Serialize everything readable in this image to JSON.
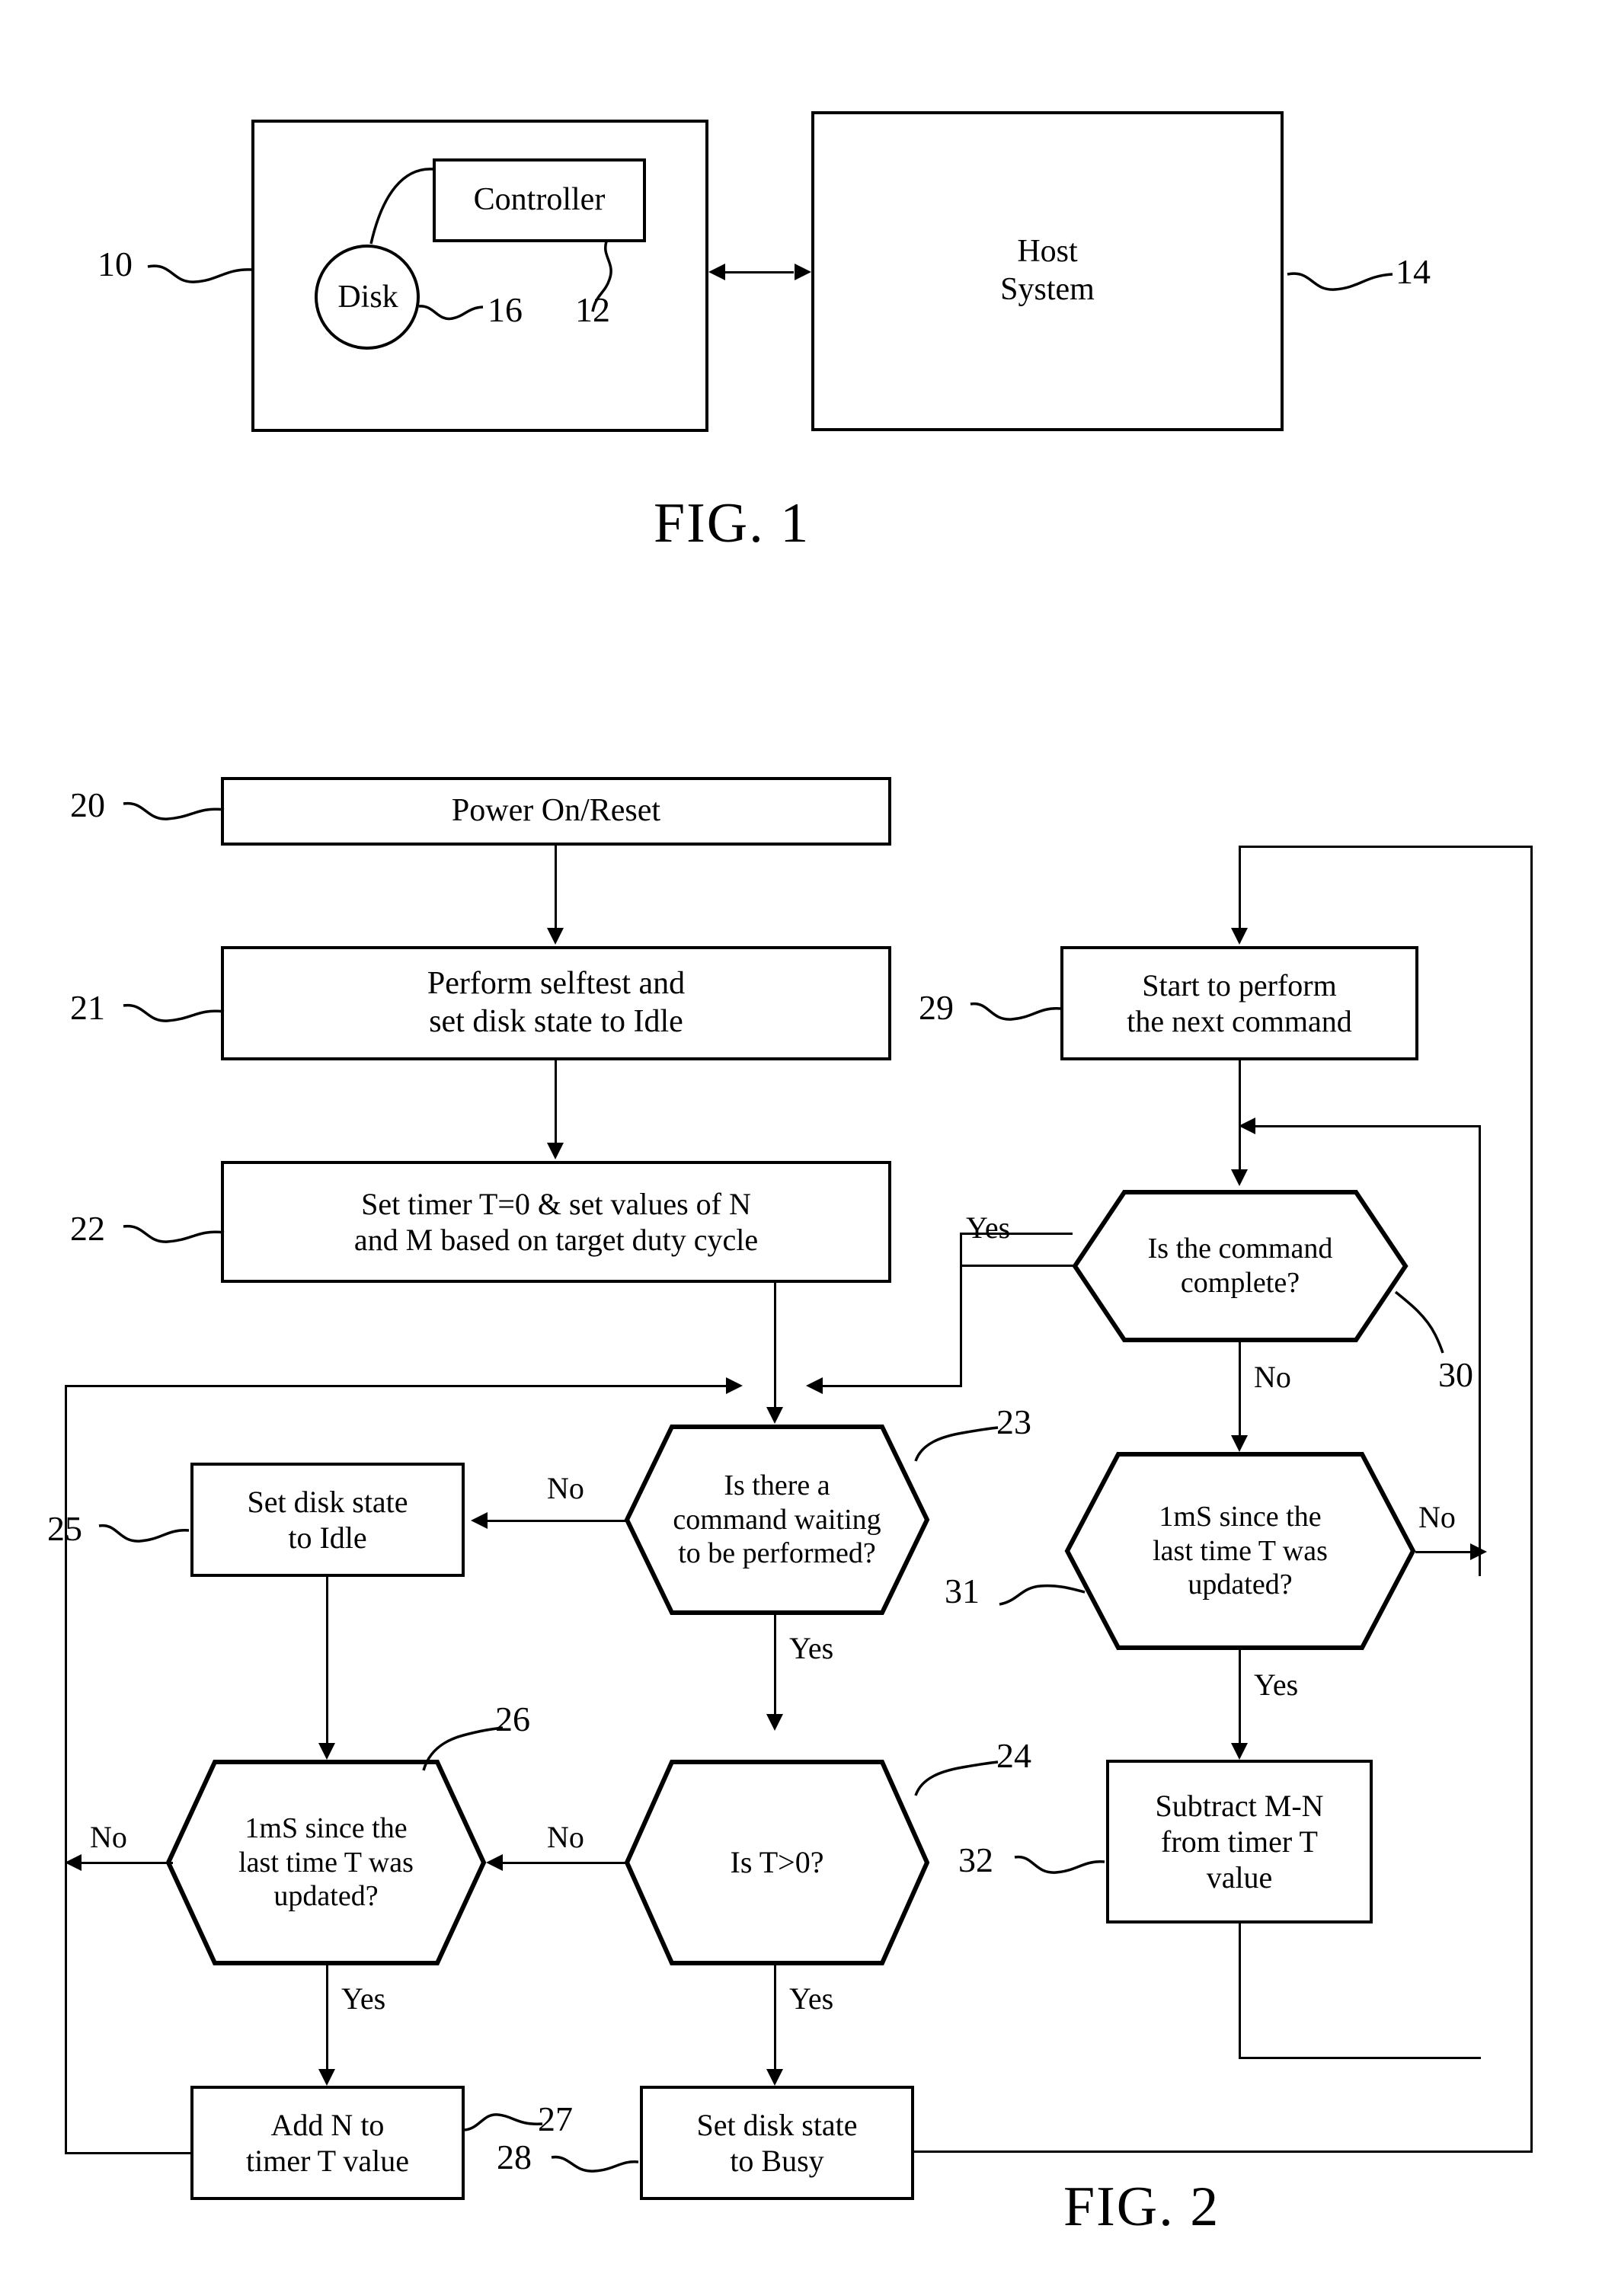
{
  "document": {
    "type": "patent-drawing-sheet",
    "figures": [
      "FIG. 1",
      "FIG. 2"
    ]
  },
  "fig1": {
    "caption": "FIG. 1",
    "disk_drive": {
      "ref": "10",
      "controller": {
        "label": "Controller",
        "ref": "12"
      },
      "disk": {
        "label": "Disk",
        "ref": "16"
      }
    },
    "host": {
      "label_line1": "Host",
      "label_line2": "System",
      "ref": "14"
    }
  },
  "fig2": {
    "caption": "FIG. 2",
    "nodes": [
      {
        "ref": "20",
        "kind": "process",
        "text": "Power On/Reset"
      },
      {
        "ref": "21",
        "kind": "process",
        "text": "Perform selftest and\nset disk state to Idle"
      },
      {
        "ref": "22",
        "kind": "process",
        "text": "Set timer T=0 & set values of N\nand M based on target duty cycle"
      },
      {
        "ref": "23",
        "kind": "decision",
        "text": "Is there a\ncommand waiting\nto be performed?"
      },
      {
        "ref": "24",
        "kind": "decision",
        "text": "Is T>0?"
      },
      {
        "ref": "25",
        "kind": "process",
        "text": "Set disk state\nto Idle"
      },
      {
        "ref": "26",
        "kind": "decision",
        "text": "1mS since the\nlast time T was\nupdated?"
      },
      {
        "ref": "27",
        "kind": "process",
        "text": "Add N to\ntimer T value"
      },
      {
        "ref": "28",
        "kind": "process",
        "text": "Set disk state\nto Busy"
      },
      {
        "ref": "29",
        "kind": "process",
        "text": "Start to perform\nthe next command"
      },
      {
        "ref": "30",
        "kind": "decision",
        "text": "Is the command\ncomplete?"
      },
      {
        "ref": "31",
        "kind": "decision",
        "text": "1mS since the\nlast time T was\nupdated?"
      },
      {
        "ref": "32",
        "kind": "process",
        "text": "Subtract M-N\nfrom timer T\nvalue"
      }
    ],
    "node_text": {
      "n20": "Power On/Reset",
      "n21_l1": "Perform selftest and",
      "n21_l2": "set disk state to Idle",
      "n22_l1": "Set timer T=0 & set values of N",
      "n22_l2": "and M based on target duty cycle",
      "n23_l1": "Is there a",
      "n23_l2": "command waiting",
      "n23_l3": "to be performed?",
      "n24": "Is T>0?",
      "n25_l1": "Set disk state",
      "n25_l2": "to Idle",
      "n26_l1": "1mS since the",
      "n26_l2": "last time T was",
      "n26_l3": "updated?",
      "n27_l1": "Add N to",
      "n27_l2": "timer T value",
      "n28_l1": "Set disk state",
      "n28_l2": "to Busy",
      "n29_l1": "Start to perform",
      "n29_l2": "the next command",
      "n30_l1": "Is the command",
      "n30_l2": "complete?",
      "n31_l1": "1mS since the",
      "n31_l2": "last time T was",
      "n31_l3": "updated?",
      "n32_l1": "Subtract M-N",
      "n32_l2": "from timer T",
      "n32_l3": "value"
    },
    "refs": {
      "r20": "20",
      "r21": "21",
      "r22": "22",
      "r23": "23",
      "r24": "24",
      "r25": "25",
      "r26": "26",
      "r27": "27",
      "r28": "28",
      "r29": "29",
      "r30": "30",
      "r31": "31",
      "r32": "32"
    },
    "branch_labels": {
      "b23_no": "No",
      "b23_yes": "Yes",
      "b24_no": "No",
      "b24_yes": "Yes",
      "b26_no": "No",
      "b26_yes": "Yes",
      "b30_yes": "Yes",
      "b30_no": "No",
      "b31_no": "No",
      "b31_yes": "Yes"
    }
  },
  "colors": {
    "ink": "#000000",
    "paper": "#ffffff"
  }
}
